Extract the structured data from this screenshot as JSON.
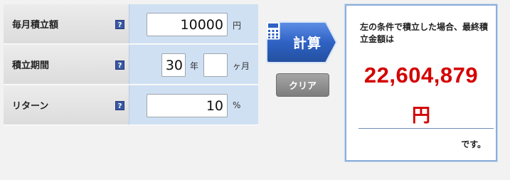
{
  "form": {
    "monthly": {
      "label": "毎月積立額",
      "value": "10000",
      "unit": "円"
    },
    "period": {
      "label": "積立期間",
      "years_value": "30",
      "years_unit": "年",
      "months_value": "",
      "months_unit": "ヶ月"
    },
    "return": {
      "label": "リターン",
      "value": "10",
      "unit": "%"
    },
    "help_glyph": "?"
  },
  "buttons": {
    "calc_label": "計算",
    "clear_label": "クリア"
  },
  "result": {
    "description": "左の条件で積立した場合、最終積立金額は",
    "amount": "22,604,879",
    "unit": "円",
    "suffix": "です。"
  },
  "colors": {
    "amount": "#d40000",
    "calc_button": "#2f62c4",
    "panel_border": "#8eb0da"
  },
  "icons": [
    "help-icon",
    "calculator-icon"
  ]
}
